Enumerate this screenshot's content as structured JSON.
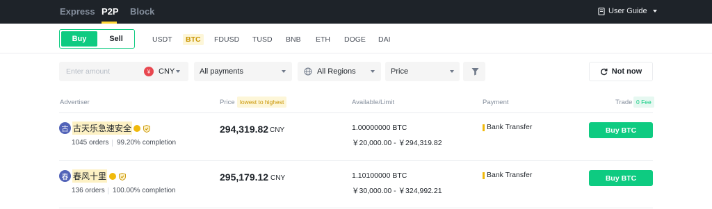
{
  "nav": {
    "tabs": [
      {
        "label": "Express"
      },
      {
        "label": "P2P"
      },
      {
        "label": "Block"
      }
    ],
    "user_guide": "User Guide"
  },
  "trade_toggle": {
    "buy": "Buy",
    "sell": "Sell"
  },
  "coins": [
    "USDT",
    "BTC",
    "FDUSD",
    "TUSD",
    "BNB",
    "ETH",
    "DOGE",
    "DAI"
  ],
  "selected_coin": "BTC",
  "filters": {
    "amount_placeholder": "Enter amount",
    "currency_symbol": "¥",
    "currency": "CNY",
    "payments": "All payments",
    "regions": "All Regions",
    "sort": "Price",
    "not_now": "Not now"
  },
  "table": {
    "headers": {
      "advertiser": "Advertiser",
      "price": "Price",
      "price_sort": "lowest to highest",
      "available": "Available/Limit",
      "payment": "Payment",
      "trade": "Trade",
      "fee": "0 Fee"
    },
    "rows": [
      {
        "avatar": "古",
        "name": "古天乐急速安全",
        "orders": "1045 orders",
        "completion": "99.20% completion",
        "price": "294,319.82",
        "currency": "CNY",
        "available": "1.00000000 BTC",
        "limit": "￥20,000.00 - ￥294,319.82",
        "payment": "Bank Transfer",
        "action": "Buy BTC"
      },
      {
        "avatar": "春",
        "name": "春风十里",
        "orders": "136 orders",
        "completion": "100.00% completion",
        "price": "295,179.12",
        "currency": "CNY",
        "available": "1.10100000 BTC",
        "limit": "￥30,000.00 - ￥324,992.21",
        "payment": "Bank Transfer",
        "action": "Buy BTC"
      }
    ]
  },
  "colors": {
    "nav_bg": "#1e2329",
    "accent_green": "#0ecb81",
    "accent_yellow": "#f0b90b",
    "highlight": "#fdf1c4"
  }
}
